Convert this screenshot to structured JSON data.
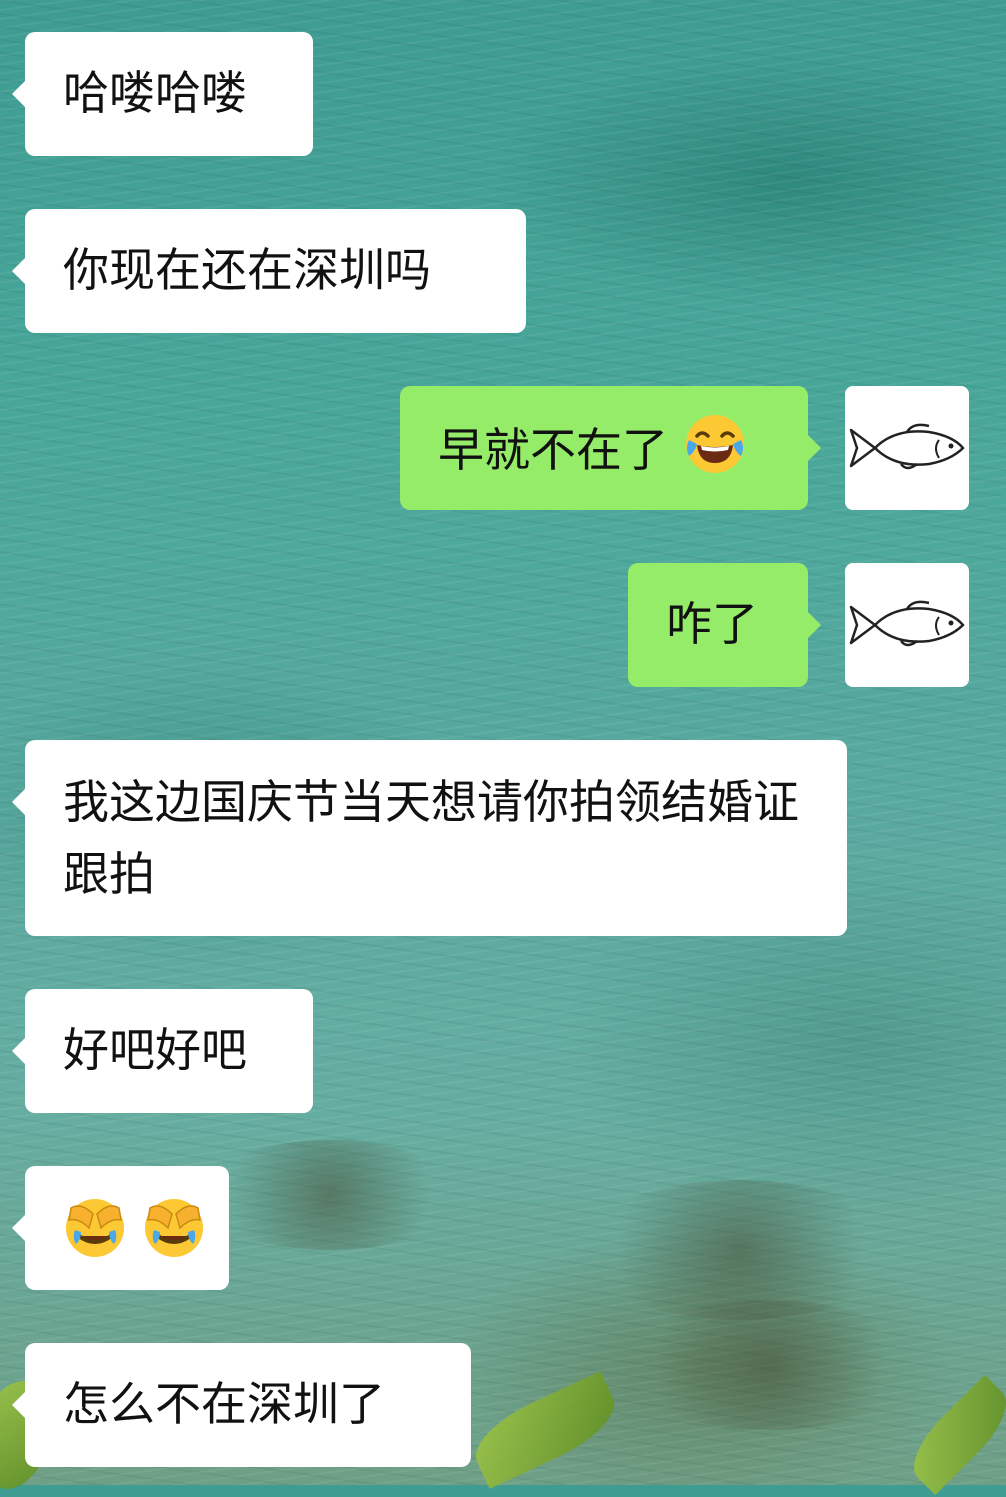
{
  "messages": [
    {
      "side": "in",
      "text": "哈喽哈喽"
    },
    {
      "side": "in",
      "text": "你现在还在深圳吗"
    },
    {
      "side": "out",
      "text": "早就不在了",
      "emoji": "face-with-tears-of-joy"
    },
    {
      "side": "out",
      "text": "咋了"
    },
    {
      "side": "in",
      "text": "我这边国庆节当天想请你拍领结婚证跟拍"
    },
    {
      "side": "in",
      "text": "好吧好吧"
    },
    {
      "side": "in",
      "emoji": "face-palm-crying-x2"
    },
    {
      "side": "in",
      "text": "怎么不在深圳了"
    }
  ],
  "my_avatar": {
    "icon": "fish-icon"
  },
  "colors": {
    "incoming_bubble": "#ffffff",
    "outgoing_bubble": "#95ec69",
    "background": "#4aa79a"
  }
}
